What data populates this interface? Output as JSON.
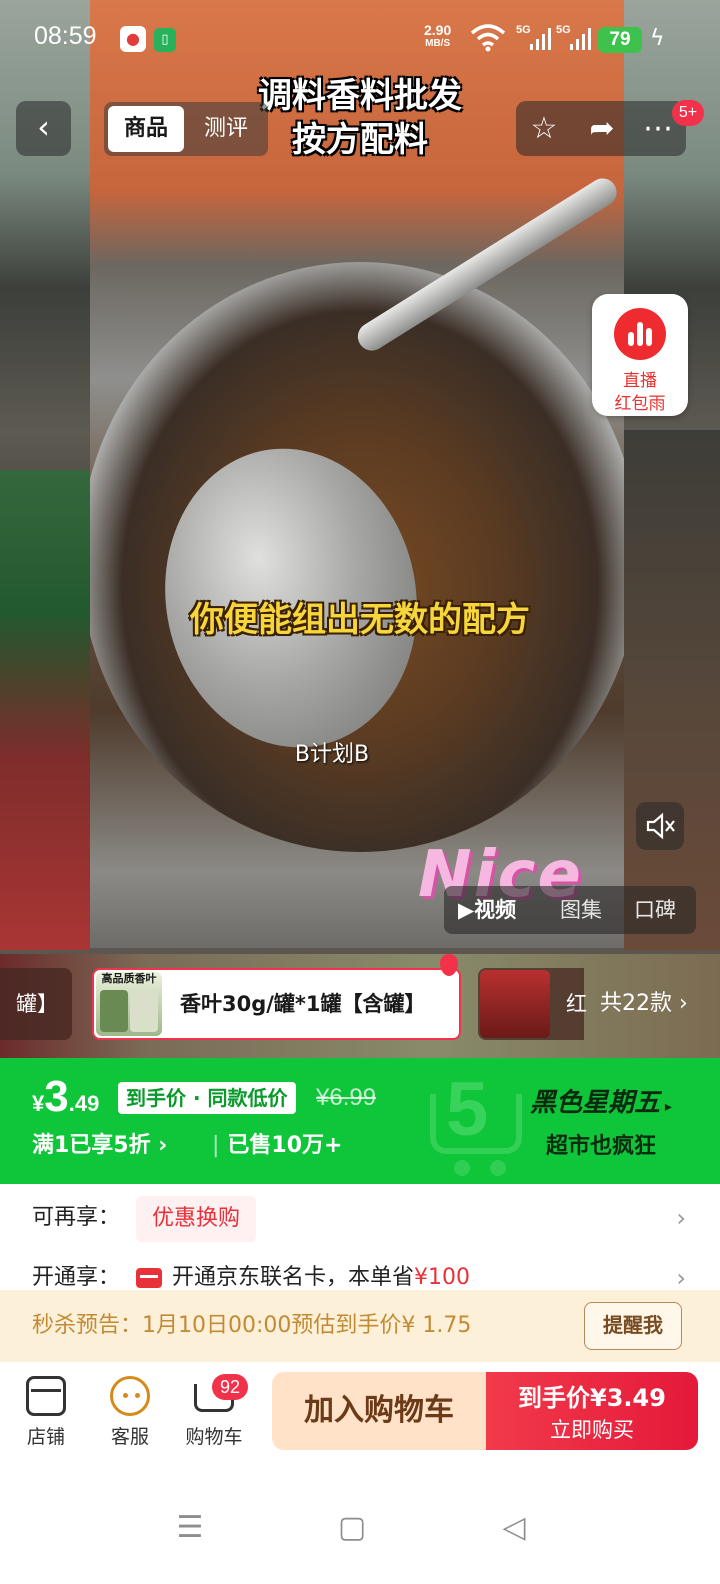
{
  "status_bar": {
    "time": "08:59",
    "speed_value": "2.90",
    "speed_unit": "MB/S",
    "signal1_label": "5G",
    "signal2_label": "5G",
    "battery": "79",
    "charging_icon": "lightning-icon"
  },
  "header": {
    "back_icon": "chevron-left-icon",
    "tabs": [
      {
        "label": "商品",
        "active": true
      },
      {
        "label": "测评",
        "active": false
      }
    ],
    "actions": [
      "star-icon",
      "share-icon",
      "more-icon"
    ],
    "more_badge": "5+"
  },
  "video": {
    "title_line1": "调料香料批发",
    "title_line2": "按方配料",
    "caption": "你便能组出无数的配方",
    "subtitle": "B计划B",
    "sticker": "Nice",
    "media_tabs": [
      "视频",
      "图集",
      "口碑"
    ]
  },
  "live_widget": {
    "line1": "直播",
    "line2": "红包雨"
  },
  "sku": {
    "prev_label": "罐】",
    "selected_thumb_caption": "高品质香叶",
    "selected_label": "香叶30g/罐*1罐【含罐】",
    "next_label": "红",
    "total": "共22款"
  },
  "price": {
    "currency": "¥",
    "integer": "3",
    "decimal": ".49",
    "tag": "到手价 · 同款低价",
    "original": "¥6.99",
    "discount": "满1已享5折",
    "sold": "已售10万+",
    "promo_title": "黑色星期五",
    "promo_sub": "超市也疯狂",
    "brand_color": "#0fc53a"
  },
  "rows": {
    "extra_label": "可再享：",
    "extra_coupon": "优惠换购",
    "open_label": "开通享：",
    "open_text": "开通京东联名卡，本单省",
    "open_amount": "¥100"
  },
  "flash_sale": {
    "text": "秒杀预告：1月10日00:00预估到手价¥ 1.75",
    "button": "提醒我"
  },
  "bottom_bar": {
    "shop": "店铺",
    "service": "客服",
    "cart": "购物车",
    "cart_badge": "92",
    "add_to_cart": "加入购物车",
    "buy_line1": "到手价¥3.49",
    "buy_line2": "立即购买",
    "accent_color": "#f2324b"
  }
}
